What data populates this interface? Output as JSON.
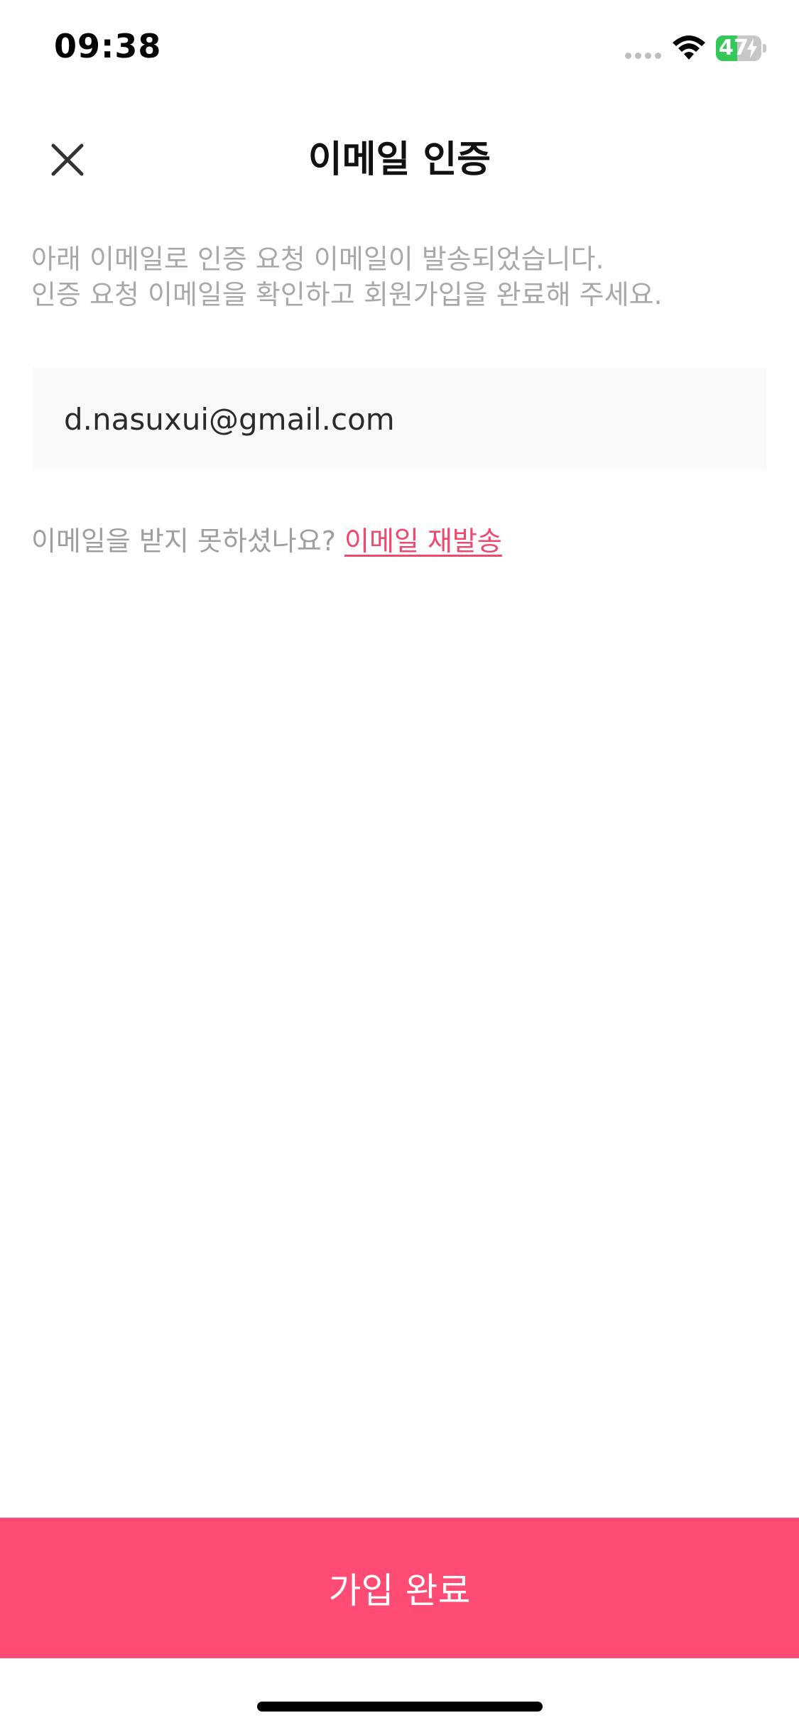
{
  "status_bar": {
    "time": "09:38",
    "battery_level": "47",
    "battery_fraction": 0.47,
    "icons": [
      "signal-icon",
      "wifi-icon",
      "battery-icon",
      "charging-bolt-icon"
    ]
  },
  "header": {
    "title": "이메일 인증",
    "close_icon": "close-icon"
  },
  "description": {
    "line1": "아래 이메일로 인증 요청 이메일이 발송되었습니다.",
    "line2": "인증 요청 이메일을 확인하고 회원가입을 완료해 주세요."
  },
  "email": {
    "value": "d.nasuxui@gmail.com"
  },
  "resend": {
    "prompt": "이메일을 받지 못하셨나요?",
    "link_label": "이메일 재발송"
  },
  "footer": {
    "complete_label": "가입 완료"
  },
  "colors": {
    "accent": "#ff4c74",
    "link": "#f0476d",
    "muted_text": "#a8a8a8",
    "input_bg": "#f9f9f9",
    "battery_green": "#34c759"
  }
}
